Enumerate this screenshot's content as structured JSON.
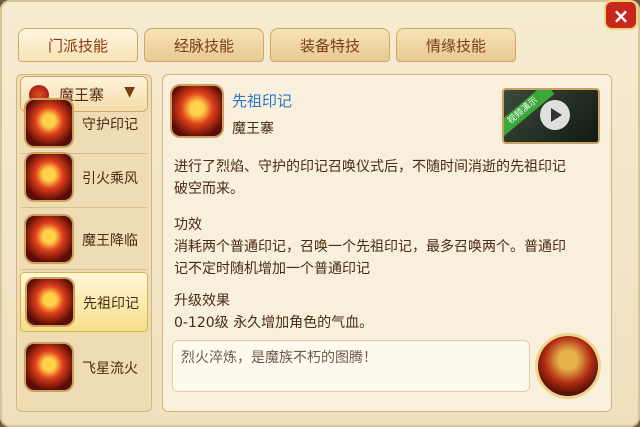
{
  "tabs": [
    {
      "label": "门派技能",
      "active": true
    },
    {
      "label": "经脉技能",
      "active": false
    },
    {
      "label": "装备特技",
      "active": false
    },
    {
      "label": "情缘技能",
      "active": false
    }
  ],
  "sect": {
    "name": "魔王寨",
    "icon": "sect-emblem-icon"
  },
  "skills": [
    {
      "label": "守护印记",
      "icon": "fire-skill-icon"
    },
    {
      "label": "引火乘风",
      "icon": "fire-skill-icon"
    },
    {
      "label": "魔王降临",
      "icon": "fire-skill-icon"
    },
    {
      "label": "先祖印记",
      "icon": "fire-skill-icon",
      "selected": true
    },
    {
      "label": "飞星流火",
      "icon": "fire-skill-icon"
    }
  ],
  "detail": {
    "name": "先祖印记",
    "sect": "魔王寨",
    "video_badge": "视频演示",
    "description": [
      "进行了烈焰、守护的印记召唤仪式后，不随时间消逝的先祖印记",
      "破空而来。"
    ],
    "effect_title": "功效",
    "effect": [
      "消耗两个普通印记，召唤一个先祖印记，最多召唤两个。普通印",
      "记不定时随机增加一个普通印记"
    ],
    "upgrade_title": "升级效果",
    "upgrade": "0-120级 永久增加角色的气血。",
    "quote": "烈火淬炼，是魔族不朽的图腾！"
  },
  "close_symbol": "×"
}
